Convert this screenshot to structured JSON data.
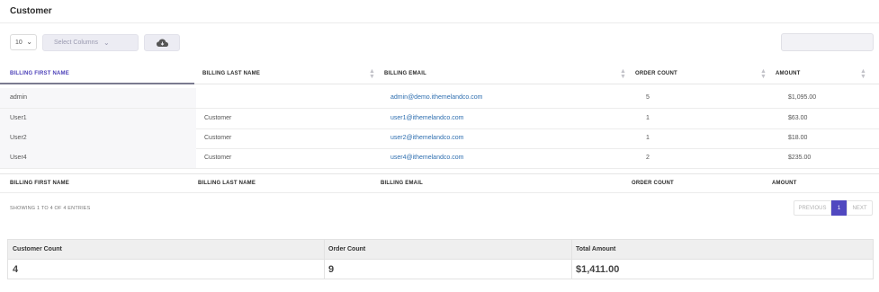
{
  "page": {
    "title": "Customer"
  },
  "toolbar": {
    "page_length": "10",
    "columns_placeholder": "Select Columns",
    "download_icon": "cloud-download-icon"
  },
  "table": {
    "headers": [
      "BILLING FIRST NAME",
      "BILLING LAST NAME",
      "BILLING EMAIL",
      "ORDER COUNT",
      "AMOUNT"
    ],
    "rows": [
      [
        "admin",
        "",
        "admin@demo.ithemelandco.com",
        "5",
        "$1,095.00"
      ],
      [
        "User1",
        "Customer",
        "user1@ithemelandco.com",
        "1",
        "$63.00"
      ],
      [
        "User2",
        "Customer",
        "user2@ithemelandco.com",
        "1",
        "$18.00"
      ],
      [
        "User4",
        "Customer",
        "user4@ithemelandco.com",
        "2",
        "$235.00"
      ]
    ],
    "footers": [
      "BILLING FIRST NAME",
      "BILLING LAST NAME",
      "BILLING EMAIL",
      "ORDER COUNT",
      "AMOUNT"
    ]
  },
  "pagination": {
    "info": "SHOWING 1 TO 4 OF 4 ENTRIES",
    "previous": "PREVIOUS",
    "current": "1",
    "next": "NEXT"
  },
  "summary": {
    "headers": [
      "Customer Count",
      "Order Count",
      "Total Amount"
    ],
    "values": [
      "4",
      "9",
      "$1,411.00"
    ]
  },
  "colors": {
    "accent": "#5048c0",
    "link": "#2f6fb0"
  }
}
